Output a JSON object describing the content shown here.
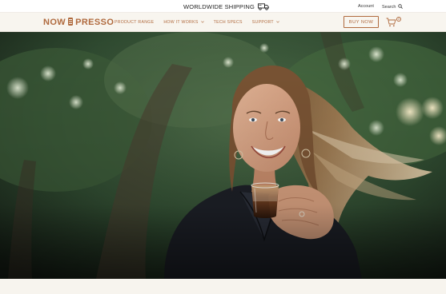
{
  "announcement": {
    "text": "WORLDWIDE SHIPPING",
    "icon": "delivery-truck-icon"
  },
  "utility": {
    "account_label": "Account",
    "search_label": "Search",
    "search_icon": "search-icon"
  },
  "nav": {
    "logo_left": "NOW",
    "logo_right": "PRESSO",
    "items": [
      {
        "label": "PRODUCT RANGE",
        "has_dropdown": false
      },
      {
        "label": "HOW IT WORKS",
        "has_dropdown": true
      },
      {
        "label": "TECH SPECS",
        "has_dropdown": false
      },
      {
        "label": "SUPPORT",
        "has_dropdown": true
      }
    ],
    "buy_label": "BUY NOW",
    "cart_count": "0"
  },
  "hero": {
    "image": "woman-holding-espresso-glass-photo"
  },
  "colors": {
    "brand": "#b06a3e",
    "nav_background": "#f8f5ef"
  }
}
